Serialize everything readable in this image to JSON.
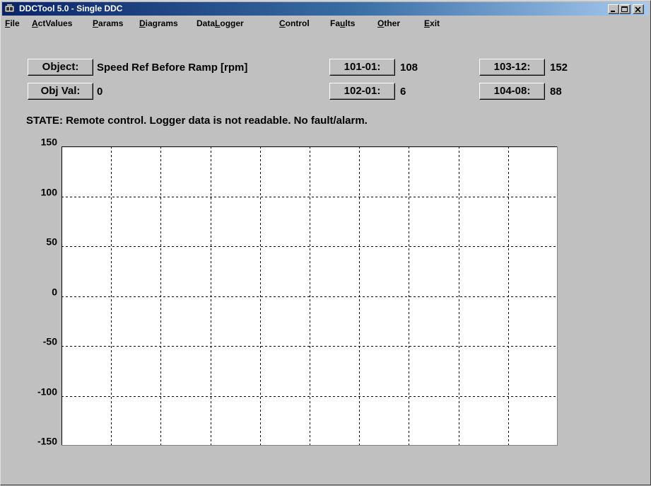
{
  "window": {
    "title": "DDCTool 5.0 - Single DDC",
    "controls": [
      "minimize",
      "maximize",
      "close"
    ]
  },
  "menu": [
    {
      "label": "File",
      "mnemonic": "F",
      "rest": "ile"
    },
    {
      "label": "ActValues",
      "mnemonic": "A",
      "rest": "ctValues"
    },
    {
      "label": "Params",
      "mnemonic": "P",
      "rest": "arams"
    },
    {
      "label": "Diagrams",
      "mnemonic": "D",
      "rest": "iagrams"
    },
    {
      "label": "DataLogger",
      "pre": "Data",
      "mnemonic": "L",
      "rest": "ogger"
    },
    {
      "label": "Control",
      "mnemonic": "C",
      "rest": "ontrol"
    },
    {
      "label": "Faults",
      "pre": "Fa",
      "mnemonic": "u",
      "rest": "lts"
    },
    {
      "label": "Other",
      "mnemonic": "O",
      "rest": "ther"
    },
    {
      "label": "Exit",
      "mnemonic": "E",
      "rest": "xit"
    }
  ],
  "params": {
    "object_btn": "Object:",
    "object_value": "Speed Ref Before Ramp [rpm]",
    "objval_btn": "Obj Val:",
    "objval_value": "0",
    "p101_btn": "101-01:",
    "p101_value": "108",
    "p102_btn": "102-01:",
    "p102_value": "6",
    "p103_btn": "103-12:",
    "p103_value": "152",
    "p104_btn": "104-08:",
    "p104_value": "88"
  },
  "state_text": "STATE: Remote control. Logger data is not readable. No fault/alarm.",
  "chart_data": {
    "type": "line",
    "title": "",
    "xlabel": "",
    "ylabel": "",
    "ylim": [
      -150,
      150
    ],
    "yticks": [
      150,
      100,
      50,
      0,
      -50,
      -100,
      -150
    ],
    "x_gridlines": 10,
    "grid": true,
    "grid_style": "dashed",
    "series": [],
    "background": "#ffffff"
  },
  "colors": {
    "titlebar_start": "#0a246a",
    "titlebar_end": "#a6caf0",
    "face": "#c0c0c0"
  }
}
